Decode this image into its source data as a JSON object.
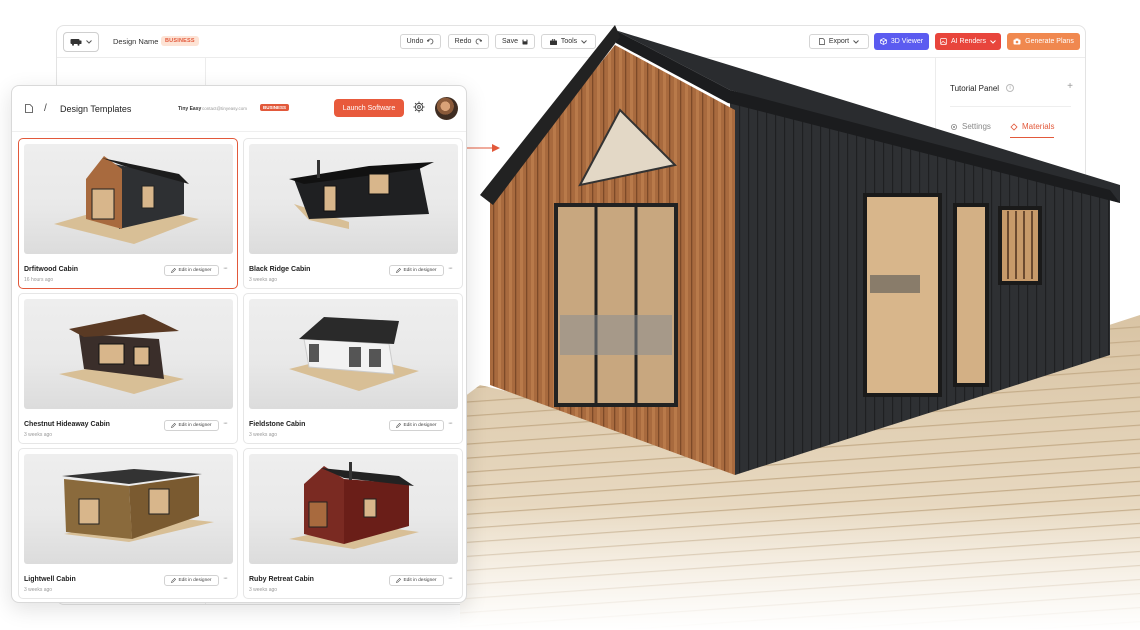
{
  "designer": {
    "design_name_label": "Design Name",
    "plan_badge": "BUSINESS",
    "toolbar": {
      "undo": "Undo",
      "redo": "Redo",
      "save": "Save",
      "tools": "Tools",
      "export": "Export",
      "viewer_3d": "3D Viewer",
      "ai_renders": "AI Renders",
      "generate_plans": "Generate Plans"
    },
    "right_panel": {
      "tutorial": "Tutorial Panel",
      "tabs": [
        {
          "label": "Settings"
        },
        {
          "label": "Materials"
        }
      ]
    }
  },
  "templates": {
    "title": "Design Templates",
    "user_name": "Tiny Easy",
    "user_email": "contact@tinyeasy.com",
    "user_badge": "BUSINESS",
    "launch_label": "Launch Software",
    "edit_label": "Edit in designer",
    "cards": [
      {
        "name": "Drfitwood Cabin",
        "date": "16 hours ago"
      },
      {
        "name": "Black Ridge Cabin",
        "date": "3 weeks ago"
      },
      {
        "name": "Chestnut Hideaway Cabin",
        "date": "3 weeks ago"
      },
      {
        "name": "Fieldstone Cabin",
        "date": "3 weeks ago"
      },
      {
        "name": "Lightwell Cabin",
        "date": "3 weeks ago"
      },
      {
        "name": "Ruby Retreat Cabin",
        "date": "3 weeks ago"
      }
    ]
  },
  "colors": {
    "accent": "#e2593b",
    "viewer_button": "#5b5bf0",
    "ai_renders_button": "#e8453c",
    "generate_plans_button": "#f0884f"
  }
}
